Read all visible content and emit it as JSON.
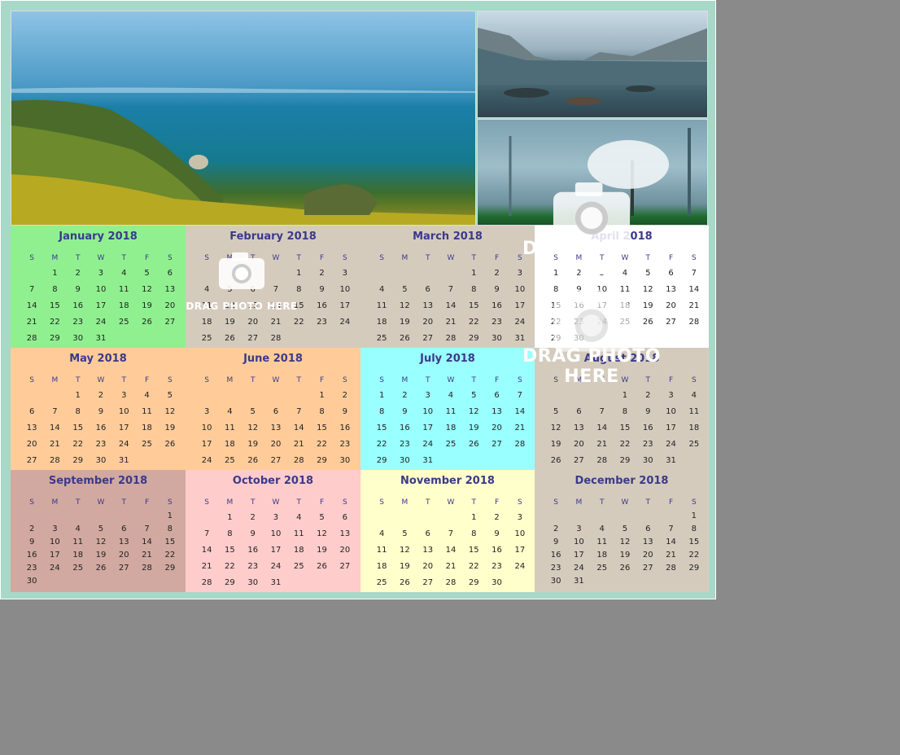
{
  "drop_zones": [
    {
      "label": "DRAG PHOTO HERE"
    },
    {
      "label": "DRAG PHOTO HERE"
    },
    {
      "label": "DRAG PHOTO HERE"
    }
  ],
  "day_headers": [
    "S",
    "M",
    "T",
    "W",
    "T",
    "F",
    "S"
  ],
  "colors": {
    "background": "#8a8a8a",
    "frame": "#a8d8c8",
    "month_title": "#3a3a8a"
  },
  "months": [
    {
      "title": "January 2018",
      "color": "#90f090",
      "start": 1,
      "days": 31
    },
    {
      "title": "February 2018",
      "color": "#d5cbbd",
      "start": 4,
      "days": 28
    },
    {
      "title": "March 2018",
      "color": "#d5cbbd",
      "start": 4,
      "days": 31
    },
    {
      "title": "April 2018",
      "color": "#ffffff",
      "start": 0,
      "days": 30
    },
    {
      "title": "May 2018",
      "color": "#ffcc99",
      "start": 2,
      "days": 31
    },
    {
      "title": "June 2018",
      "color": "#ffcc99",
      "start": 5,
      "days": 30
    },
    {
      "title": "July 2018",
      "color": "#99ffff",
      "start": 0,
      "days": 31
    },
    {
      "title": "August 2018",
      "color": "#d5cbbd",
      "start": 3,
      "days": 31
    },
    {
      "title": "September 2018",
      "color": "#d1a9a0",
      "start": 6,
      "days": 30
    },
    {
      "title": "October 2018",
      "color": "#ffcccc",
      "start": 1,
      "days": 31
    },
    {
      "title": "November 2018",
      "color": "#ffffcc",
      "start": 4,
      "days": 30
    },
    {
      "title": "December 2018",
      "color": "#d5cbbd",
      "start": 6,
      "days": 31
    }
  ]
}
